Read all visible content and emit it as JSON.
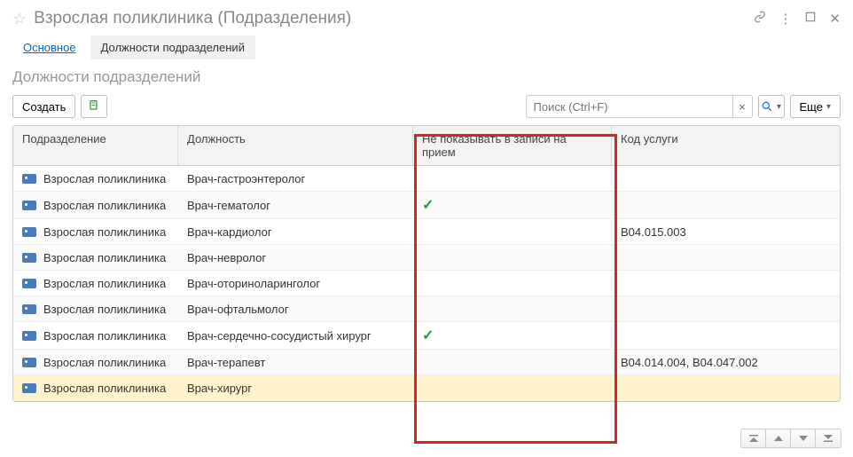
{
  "header": {
    "title": "Взрослая поликлиника (Подразделения)"
  },
  "tabs": {
    "main": "Основное",
    "positions": "Должности подразделений"
  },
  "section_title": "Должности подразделений",
  "toolbar": {
    "create": "Создать",
    "more": "Еще",
    "search_placeholder": "Поиск (Ctrl+F)"
  },
  "columns": {
    "department": "Подразделение",
    "position": "Должность",
    "hide_in_appt": "Не показывать в записи на прием",
    "service_code": "Код услуги"
  },
  "rows": [
    {
      "dept": "Взрослая поликлиника",
      "pos": "Врач-гастроэнтеролог",
      "hide": false,
      "code": ""
    },
    {
      "dept": "Взрослая поликлиника",
      "pos": "Врач-гематолог",
      "hide": true,
      "code": ""
    },
    {
      "dept": "Взрослая поликлиника",
      "pos": "Врач-кардиолог",
      "hide": false,
      "code": "B04.015.003"
    },
    {
      "dept": "Взрослая поликлиника",
      "pos": "Врач-невролог",
      "hide": false,
      "code": ""
    },
    {
      "dept": "Взрослая поликлиника",
      "pos": "Врач-оториноларинголог",
      "hide": false,
      "code": ""
    },
    {
      "dept": "Взрослая поликлиника",
      "pos": "Врач-офтальмолог",
      "hide": false,
      "code": ""
    },
    {
      "dept": "Взрослая поликлиника",
      "pos": "Врач-сердечно-сосудистый хирург",
      "hide": true,
      "code": ""
    },
    {
      "dept": "Взрослая поликлиника",
      "pos": "Врач-терапевт",
      "hide": false,
      "code": "B04.014.004, B04.047.002"
    },
    {
      "dept": "Взрослая поликлиника",
      "pos": "Врач-хирург",
      "hide": false,
      "code": ""
    }
  ],
  "selected_index": 8
}
